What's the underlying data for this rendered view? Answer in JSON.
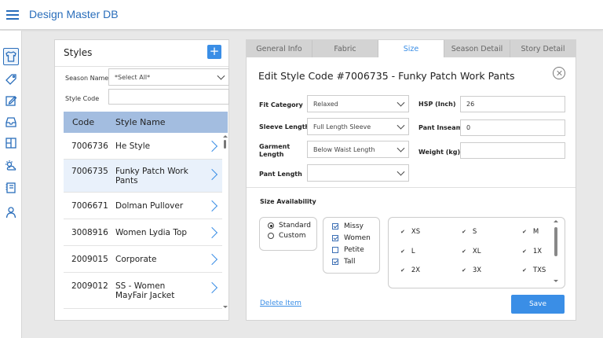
{
  "app": {
    "title": "Design Master DB"
  },
  "rail": {
    "icons": [
      "shirt-icon",
      "tag-icon",
      "edit-icon",
      "tray-icon",
      "layout-icon",
      "weather-icon",
      "notebook-icon",
      "user-icon"
    ]
  },
  "styles": {
    "title": "Styles",
    "add_label": "+",
    "season_label": "Season Name",
    "season_value": "*Select All*",
    "code_label": "Style Code",
    "code_value": "",
    "columns": {
      "code": "Code",
      "name": "Style Name"
    },
    "rows": [
      {
        "code": "7006736",
        "name": "He Style"
      },
      {
        "code": "7006735",
        "name": "Funky Patch Work Pants"
      },
      {
        "code": "7006671",
        "name": "Dolman Pullover"
      },
      {
        "code": "3008916",
        "name": "Women Lydia Top"
      },
      {
        "code": "2009015",
        "name": "Corporate"
      },
      {
        "code": "2009012",
        "name": "SS - Women MayFair Jacket"
      }
    ]
  },
  "edit": {
    "tabs": [
      "General Info",
      "Fabric",
      "Size",
      "Season Detail",
      "Story Detail"
    ],
    "active_tab": "Size",
    "title": "Edit Style Code #7006735 - Funky Patch Work Pants",
    "fields": {
      "fit_category": {
        "label": "Fit Category",
        "value": "Relaxed"
      },
      "sleeve_length": {
        "label": "Sleeve Length",
        "value": "Full Length Sleeve"
      },
      "garment_length": {
        "label": "Garment Length",
        "value": "Below Waist Length"
      },
      "pant_length": {
        "label": "Pant Length",
        "value": ""
      },
      "hsp": {
        "label": "HSP (Inch)",
        "value": "26"
      },
      "pant_inseam": {
        "label": "Pant Inseam",
        "value": "0"
      },
      "weight": {
        "label": "Weight (kg)",
        "value": ""
      }
    },
    "size_availability": {
      "label": "Size Availability",
      "types": [
        {
          "label": "Standard",
          "selected": true
        },
        {
          "label": "Custom",
          "selected": false
        }
      ],
      "categories": [
        {
          "label": "Missy",
          "checked": true
        },
        {
          "label": "Women",
          "checked": true
        },
        {
          "label": "Petite",
          "checked": false
        },
        {
          "label": "Tall",
          "checked": true
        }
      ],
      "sizes": [
        "XS",
        "S",
        "M",
        "L",
        "XL",
        "1X",
        "2X",
        "3X",
        "TXS"
      ]
    },
    "delete_label": "Delete Item",
    "save_label": "Save"
  },
  "colors": {
    "accent": "#3a8ee6",
    "header_blue": "#a3bde0",
    "brand": "#2a6ebb"
  }
}
